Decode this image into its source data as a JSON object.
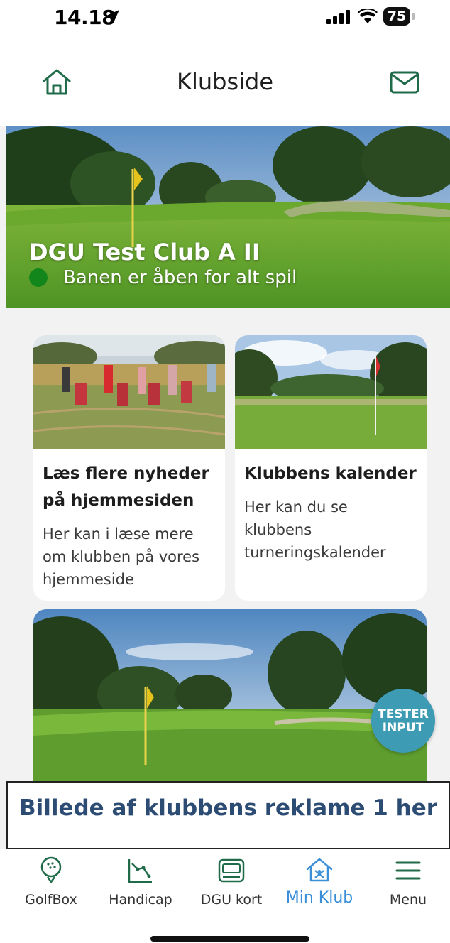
{
  "status_bar": {
    "time": "14.18",
    "battery": "75"
  },
  "header": {
    "title": "Klubside"
  },
  "hero": {
    "club_name": "DGU Test Club A II",
    "course_status": "Banen er åben for alt spil",
    "status_color": "#13861b"
  },
  "cards": [
    {
      "title": "Læs flere nyheder på hjemmesiden",
      "body": "Her kan i læse mere om klubben på vores hjemmeside"
    },
    {
      "title": "Klubbens kalender",
      "body": "Her kan du se klubbens turneringskalender"
    }
  ],
  "tester_button": {
    "line1": "TESTER",
    "line2": "INPUT"
  },
  "ad_banner": {
    "text": "Billede af klubbens reklame 1 her"
  },
  "tabbar": {
    "items": [
      {
        "label": "GolfBox",
        "icon": "golf-ball-icon"
      },
      {
        "label": "Handicap",
        "icon": "handicap-chart-icon"
      },
      {
        "label": "DGU kort",
        "icon": "card-icon"
      },
      {
        "label": "Min Klub",
        "icon": "club-house-icon",
        "active": true
      },
      {
        "label": "Menu",
        "icon": "hamburger-icon"
      }
    ]
  },
  "colors": {
    "brand_green": "#1f6b4a",
    "active_tab": "#3a8fd8",
    "ad_text": "#2d4c73",
    "tester_bg": "#3d9bb4"
  }
}
